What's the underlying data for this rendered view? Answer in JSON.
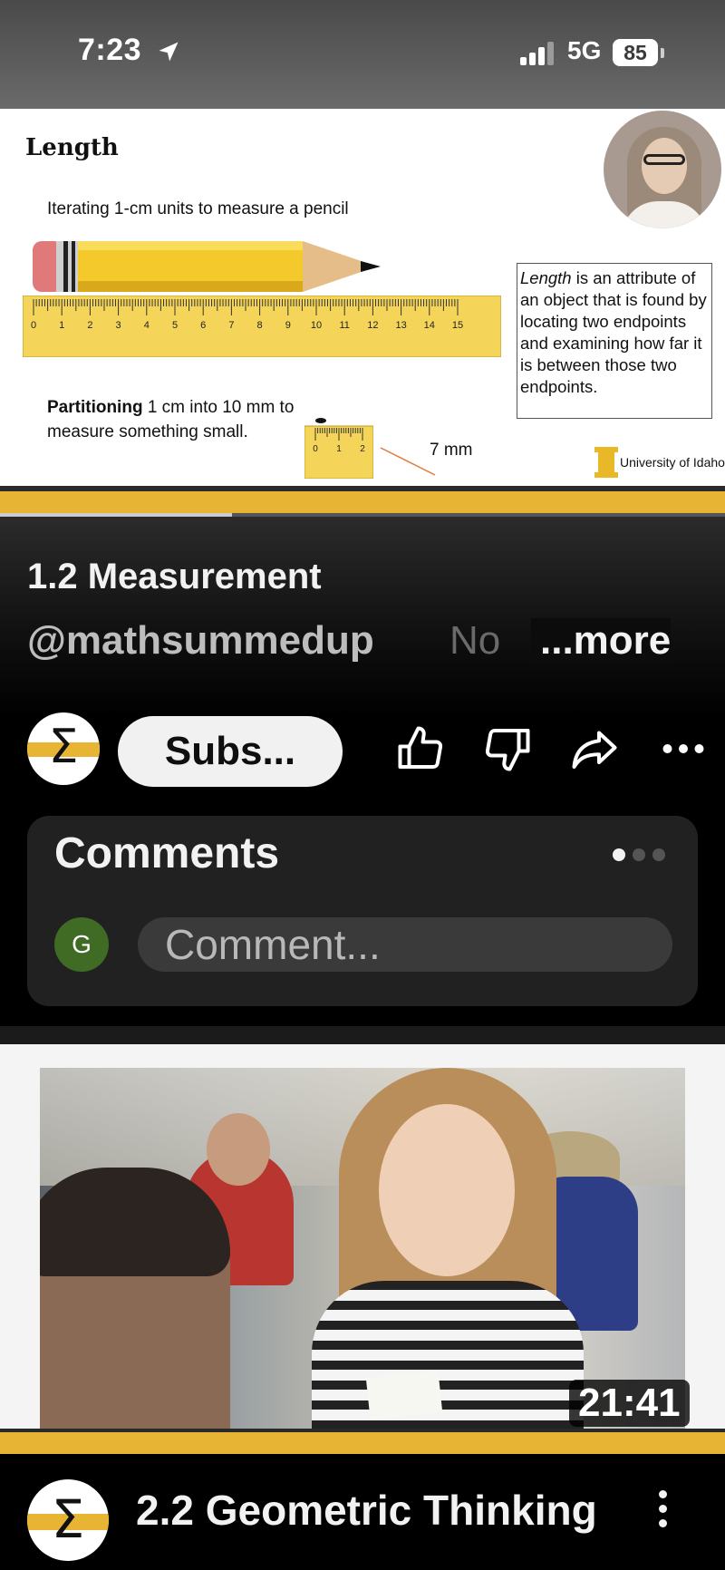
{
  "status_bar": {
    "time": "7:23",
    "network": "5G",
    "battery": "85"
  },
  "slide": {
    "title": "Length",
    "subtitle_iterating": "Iterating 1-cm units to measure a pencil",
    "partition_bold": "Partitioning",
    "partition_rest": " 1 cm into 10 mm to measure something small.",
    "ruler_ticks": [
      "0",
      "1",
      "2",
      "3",
      "4",
      "5",
      "6",
      "7",
      "8",
      "9",
      "10",
      "11",
      "12",
      "13",
      "14",
      "15"
    ],
    "small_ruler_ticks": [
      "0",
      "1",
      "2"
    ],
    "measure_label": "7 mm",
    "definition_italic": "Length",
    "definition_rest": " is an attribute of an object that is found by locating two endpoints and examining how far it is between those two endpoints.",
    "logo_text": "University of Idaho"
  },
  "player": {
    "progress_fraction": 0.32
  },
  "video": {
    "title": "1.2 Measurement",
    "channel_handle": "@mathsummedup",
    "description_fragment": "No",
    "more_label": "...more",
    "subscribe_label": "Subs...",
    "avatar_symbol": "Σ"
  },
  "comments": {
    "title": "Comments",
    "user_initial": "G",
    "placeholder": "Comment..."
  },
  "next_video": {
    "duration": "21:41",
    "title": "2.2 Geometric Thinking",
    "avatar_symbol": "Σ"
  },
  "colors": {
    "brand_gold": "#e7b533",
    "background": "#000000",
    "card": "#212121",
    "avatar_green": "#3f6b25"
  },
  "icons": [
    "location-arrow-icon",
    "signal-icon",
    "battery-icon",
    "thumbs-up-icon",
    "thumbs-down-icon",
    "share-icon",
    "more-horizontal-icon",
    "more-vertical-icon"
  ]
}
